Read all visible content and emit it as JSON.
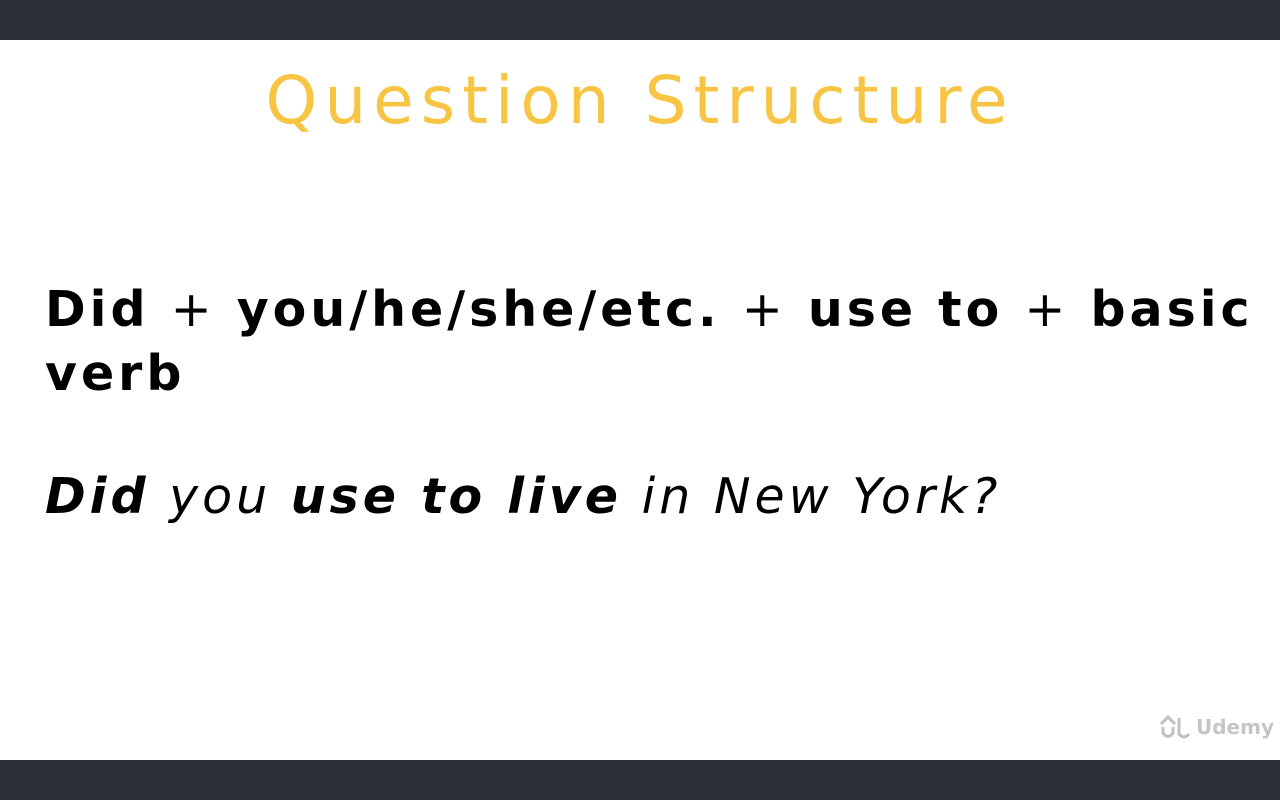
{
  "slide": {
    "title": "Question Structure",
    "formula": {
      "part1": "Did",
      "plus1": "+",
      "part2": "you/he/she/etc.",
      "plus2": "+",
      "part3": "use to",
      "plus3": "+",
      "part4": "basic verb"
    },
    "example": {
      "w1": "Did",
      "w2": "you",
      "w3": "use to live",
      "w4": "in New York?"
    }
  },
  "watermark": {
    "logo_icon": "udemy-logo-icon",
    "text": "Udemy"
  },
  "colors": {
    "title": "#f8c444",
    "letterbox": "#2b303a",
    "slide_background": "#ffffff",
    "text": "#000000"
  }
}
